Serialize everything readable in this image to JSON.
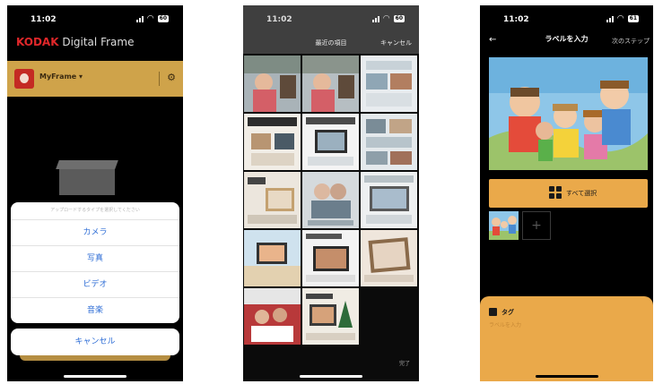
{
  "screen1": {
    "status_time": "11:02",
    "battery": "60",
    "brand": "KODAK",
    "app_name": " Digital Frame",
    "frame_name": "MyFrame",
    "sheet_prompt": "アップロードするタイプを選択してください",
    "options": [
      "カメラ",
      "写真",
      "ビデオ",
      "音楽"
    ],
    "cancel": "キャンセル"
  },
  "screen2": {
    "status_time": "11:02",
    "battery": "60",
    "title": "最近の項目",
    "cancel": "キャンセル",
    "done": "完了",
    "thumbnail_count": 14
  },
  "screen3": {
    "status_time": "11:02",
    "battery": "61",
    "title": "ラベルを入力",
    "next": "次のステップ",
    "select_all": "すべて選択",
    "add": "+",
    "tag_title": "タグ",
    "tag_placeholder": "ラベルを入力"
  },
  "colors": {
    "accent_orange": "#eaa94a",
    "frame_bar_gold": "#cfa34a",
    "kodak_red": "#e0272a",
    "ios_blue": "#2f6ed6"
  }
}
